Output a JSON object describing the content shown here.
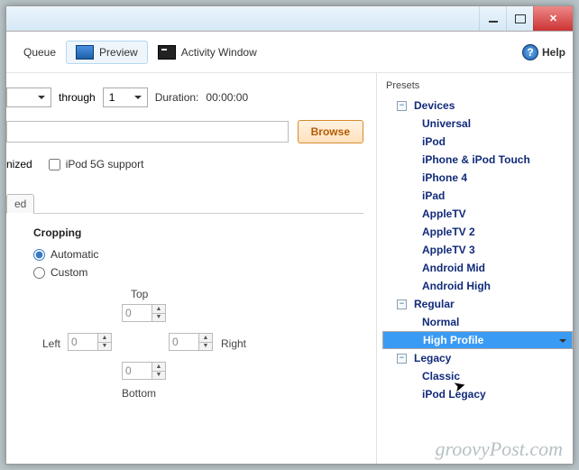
{
  "titlebar": {
    "min": "minimize",
    "max": "maximize",
    "close": "close"
  },
  "toolbar": {
    "queue": "Queue",
    "preview": "Preview",
    "activity": "Activity Window",
    "help": "Help"
  },
  "range": {
    "from_value": "",
    "through_label": "through",
    "to_value": "1",
    "duration_label": "Duration:",
    "duration_value": "00:00:00"
  },
  "source": {
    "path": "",
    "browse": "Browse"
  },
  "options": {
    "nized_suffix": "nized",
    "ipod5g": "iPod 5G support"
  },
  "tab": {
    "ed_suffix": "ed"
  },
  "cropping": {
    "title": "Cropping",
    "auto": "Automatic",
    "custom": "Custom",
    "top": "Top",
    "bottom": "Bottom",
    "left": "Left",
    "right": "Right",
    "val_top": "0",
    "val_bottom": "0",
    "val_left": "0",
    "val_right": "0"
  },
  "presets": {
    "label": "Presets",
    "groups": [
      {
        "name": "Devices",
        "expanded": true,
        "items": [
          "Universal",
          "iPod",
          "iPhone & iPod Touch",
          "iPhone 4",
          "iPad",
          "AppleTV",
          "AppleTV 2",
          "AppleTV 3",
          "Android Mid",
          "Android High"
        ]
      },
      {
        "name": "Regular",
        "expanded": true,
        "items": [
          "Normal",
          "High Profile"
        ]
      },
      {
        "name": "Legacy",
        "expanded": true,
        "items": [
          "Classic",
          "iPod Legacy"
        ]
      }
    ],
    "selected": "High Profile"
  },
  "watermark": "groovyPost.com"
}
